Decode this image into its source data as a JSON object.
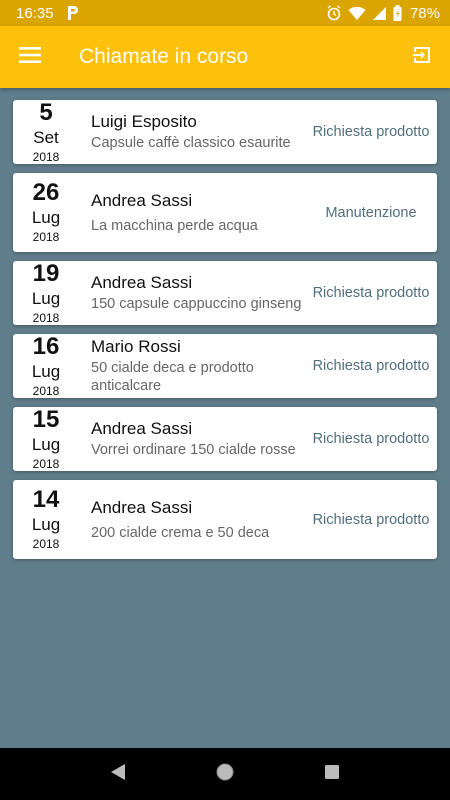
{
  "statusbar": {
    "time": "16:35",
    "battery": "78%"
  },
  "appbar": {
    "title": "Chiamate in corso"
  },
  "calls": [
    {
      "day": "5",
      "month": "Set",
      "year": "2018",
      "name": "Luigi Esposito",
      "desc": "Capsule caffè classico esaurite",
      "type": "Richiesta prodotto"
    },
    {
      "day": "26",
      "month": "Lug",
      "year": "2018",
      "name": "Andrea Sassi",
      "desc": "La macchina perde acqua",
      "type": "Manutenzione"
    },
    {
      "day": "19",
      "month": "Lug",
      "year": "2018",
      "name": "Andrea Sassi",
      "desc": "150 capsule cappuccino ginseng",
      "type": "Richiesta prodotto"
    },
    {
      "day": "16",
      "month": "Lug",
      "year": "2018",
      "name": "Mario Rossi",
      "desc": "50 cialde deca e prodotto anticalcare",
      "type": "Richiesta prodotto"
    },
    {
      "day": "15",
      "month": "Lug",
      "year": "2018",
      "name": "Andrea Sassi",
      "desc": "Vorrei ordinare 150 cialde rosse",
      "type": "Richiesta prodotto"
    },
    {
      "day": "14",
      "month": "Lug",
      "year": "2018",
      "name": "Andrea Sassi",
      "desc": "200 cialde crema e 50 deca",
      "type": "Richiesta prodotto"
    }
  ],
  "colors": {
    "appbar": "#fec10b",
    "statusbar": "#dba500",
    "background": "#607d8b",
    "type_text": "#4f6f7e"
  },
  "icons": {
    "menu": "hamburger-menu-icon",
    "logout": "exit-icon",
    "back": "back-triangle-icon",
    "home": "home-circle-icon",
    "recents": "recents-square-icon"
  }
}
